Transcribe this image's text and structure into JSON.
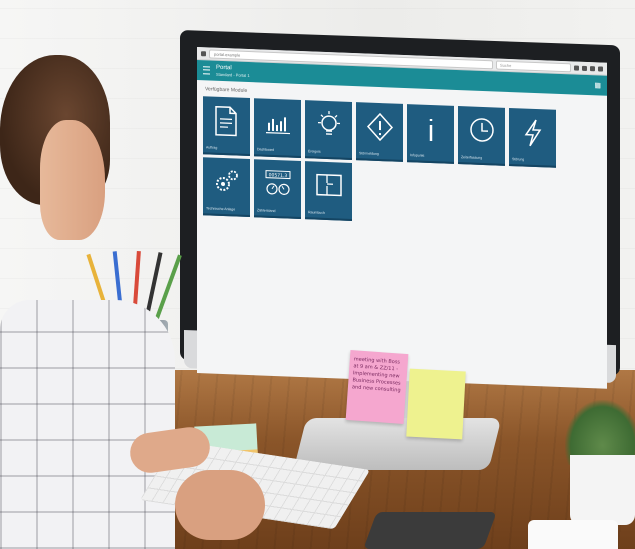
{
  "browser": {
    "url": "portal.example",
    "search_placeholder": "Suche"
  },
  "app": {
    "title": "Portal",
    "subtitle": "Standard - Portal 1",
    "section_label": "Verfügbare Module",
    "tiles": [
      {
        "label": "Auftrag",
        "icon": "document-icon"
      },
      {
        "label": "Dashboard",
        "icon": "bar-chart-icon"
      },
      {
        "label": "Ereignis",
        "icon": "lightbulb-icon"
      },
      {
        "label": "Störmeldung",
        "icon": "warning-icon"
      },
      {
        "label": "Infopunkt",
        "icon": "info-icon"
      },
      {
        "label": "Zeiterfassung",
        "icon": "clock-icon"
      },
      {
        "label": "Störung",
        "icon": "lightning-icon"
      },
      {
        "label": "Technische Anlage",
        "icon": "gears-icon"
      },
      {
        "label": "Zählerstand",
        "icon": "meter-icon"
      },
      {
        "label": "Raumbuch",
        "icon": "floorplan-icon"
      }
    ],
    "meter_value": "00571.3"
  },
  "sticky_note_text": "meeting with Boss at 9 am & ZZ/11 - Implementing new Business Processes and new consulting",
  "colors": {
    "app_bar": "#1b8c96",
    "tile": "#1f5c80"
  }
}
